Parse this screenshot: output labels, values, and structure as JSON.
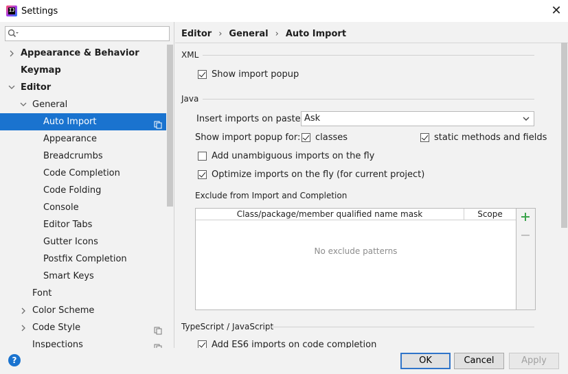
{
  "window": {
    "title": "Settings",
    "app_icon_text": "IJ"
  },
  "search": {
    "placeholder": ""
  },
  "tree": [
    {
      "label": "Appearance & Behavior",
      "bold": true,
      "level": 0,
      "arrow": "right"
    },
    {
      "label": "Keymap",
      "bold": true,
      "level": 0,
      "arrow": ""
    },
    {
      "label": "Editor",
      "bold": true,
      "level": 0,
      "arrow": "down"
    },
    {
      "label": "General",
      "bold": false,
      "level": 1,
      "arrow": "down"
    },
    {
      "label": "Auto Import",
      "bold": false,
      "level": 2,
      "arrow": "",
      "selected": true,
      "copy": true
    },
    {
      "label": "Appearance",
      "bold": false,
      "level": 2,
      "arrow": ""
    },
    {
      "label": "Breadcrumbs",
      "bold": false,
      "level": 2,
      "arrow": ""
    },
    {
      "label": "Code Completion",
      "bold": false,
      "level": 2,
      "arrow": ""
    },
    {
      "label": "Code Folding",
      "bold": false,
      "level": 2,
      "arrow": ""
    },
    {
      "label": "Console",
      "bold": false,
      "level": 2,
      "arrow": ""
    },
    {
      "label": "Editor Tabs",
      "bold": false,
      "level": 2,
      "arrow": ""
    },
    {
      "label": "Gutter Icons",
      "bold": false,
      "level": 2,
      "arrow": ""
    },
    {
      "label": "Postfix Completion",
      "bold": false,
      "level": 2,
      "arrow": ""
    },
    {
      "label": "Smart Keys",
      "bold": false,
      "level": 2,
      "arrow": ""
    },
    {
      "label": "Font",
      "bold": false,
      "level": 1,
      "arrow": ""
    },
    {
      "label": "Color Scheme",
      "bold": false,
      "level": 1,
      "arrow": "right"
    },
    {
      "label": "Code Style",
      "bold": false,
      "level": 1,
      "arrow": "right",
      "copy": true
    },
    {
      "label": "Inspections",
      "bold": false,
      "level": 1,
      "arrow": "",
      "copy": true
    }
  ],
  "breadcrumb": [
    "Editor",
    "General",
    "Auto Import"
  ],
  "sections": {
    "xml": "XML",
    "java": "Java",
    "exclude": "Exclude from Import and Completion",
    "ts": "TypeScript / JavaScript"
  },
  "xml": {
    "show_import_popup": {
      "label": "Show import popup",
      "checked": true
    }
  },
  "java": {
    "insert_imports_label": "Insert imports on paste:",
    "insert_imports_value": "Ask",
    "show_popup_for_label": "Show import popup for:",
    "classes": {
      "label": "classes",
      "checked": true
    },
    "static_methods": {
      "label": "static methods and fields",
      "checked": true
    },
    "add_unambiguous": {
      "label": "Add unambiguous imports on the fly",
      "checked": false
    },
    "optimize_imports": {
      "label": "Optimize imports on the fly (for current project)",
      "checked": true
    }
  },
  "exclude_table": {
    "columns": [
      "Class/package/member qualified name mask",
      "Scope"
    ],
    "empty_text": "No exclude patterns"
  },
  "ts": {
    "es6_imports": {
      "label": "Add ES6 imports on code completion",
      "checked": true
    }
  },
  "buttons": {
    "ok": "OK",
    "cancel": "Cancel",
    "apply": "Apply",
    "help": "?"
  },
  "colors": {
    "selection": "#1a73cf",
    "add_icon": "#3aa34b",
    "background": "#f2f2f2"
  }
}
